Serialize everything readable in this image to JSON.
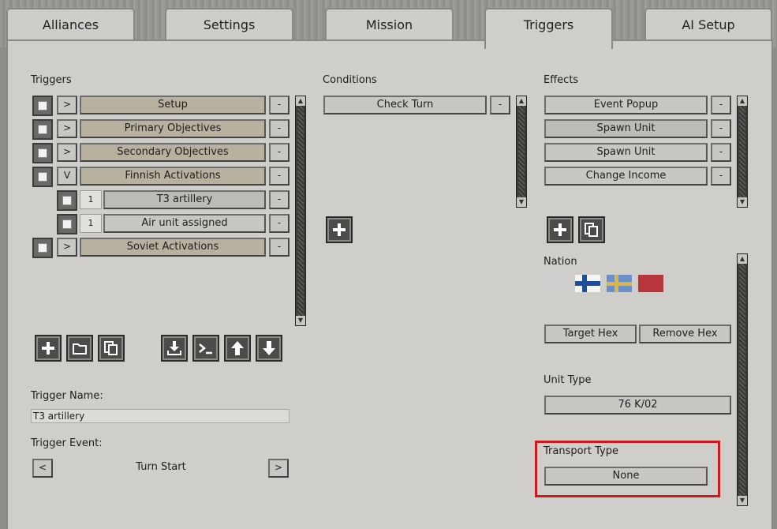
{
  "tabs": [
    {
      "label": "Alliances"
    },
    {
      "label": "Settings"
    },
    {
      "label": "Mission"
    },
    {
      "label": "Triggers"
    },
    {
      "label": "AI Setup"
    }
  ],
  "triggers": {
    "header": "Triggers",
    "items": [
      {
        "toggle": ">",
        "label": "Setup",
        "remove": "-"
      },
      {
        "toggle": ">",
        "label": "Primary Objectives",
        "remove": "-"
      },
      {
        "toggle": ">",
        "label": "Secondary Objectives",
        "remove": "-"
      },
      {
        "toggle": "V",
        "label": "Finnish Activations",
        "remove": "-"
      },
      {
        "num": "1",
        "label": "T3 artillery",
        "remove": "-"
      },
      {
        "num": "1",
        "label": "Air unit assigned",
        "remove": "-"
      },
      {
        "toggle": ">",
        "label": "Soviet Activations",
        "remove": "-"
      }
    ]
  },
  "conditions": {
    "header": "Conditions",
    "items": [
      {
        "label": "Check Turn",
        "remove": "-"
      }
    ]
  },
  "effects": {
    "header": "Effects",
    "items": [
      {
        "label": "Event Popup",
        "remove": "-"
      },
      {
        "label": "Spawn Unit",
        "remove": "-"
      },
      {
        "label": "Spawn Unit",
        "remove": "-"
      },
      {
        "label": "Change Income",
        "remove": "-"
      }
    ]
  },
  "nation": {
    "label": "Nation",
    "flags": [
      {
        "name": "neutral-flag",
        "color": "#c9c9c9"
      },
      {
        "name": "finland-flag",
        "color": "#1f4f9a"
      },
      {
        "name": "sweden-flag",
        "color": "#d8b648"
      },
      {
        "name": "soviet-flag",
        "color": "#b8353b"
      }
    ]
  },
  "hex": {
    "target": "Target Hex",
    "remove": "Remove Hex"
  },
  "unit_type": {
    "label": "Unit Type",
    "value": "76 K/02"
  },
  "transport_type": {
    "label": "Transport Type",
    "value": "None"
  },
  "trigger_name": {
    "label": "Trigger Name:",
    "value": "T3 artillery"
  },
  "trigger_event": {
    "label": "Trigger Event:",
    "prev": "<",
    "value": "Turn Start",
    "next": ">"
  }
}
